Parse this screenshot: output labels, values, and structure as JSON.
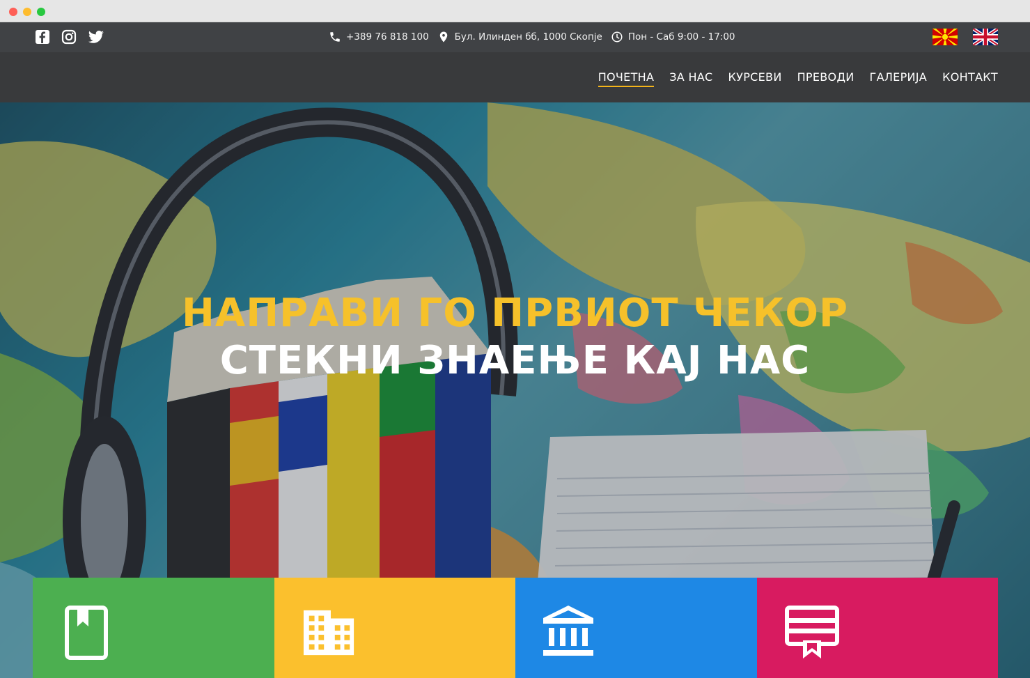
{
  "topbar": {
    "social": [
      {
        "icon": "facebook-icon"
      },
      {
        "icon": "instagram-icon"
      },
      {
        "icon": "twitter-icon"
      }
    ],
    "phone": "+389 76 818 100",
    "address": "Бул. Илинден бб, 1000 Скопје",
    "hours": "Пон - Саб 9:00 - 17:00",
    "languages": [
      {
        "icon": "macedonian-flag-icon"
      },
      {
        "icon": "uk-flag-icon"
      }
    ]
  },
  "nav": {
    "items": [
      "ПОЧЕТНА",
      "ЗА НАС",
      "КУРСЕВИ",
      "ПРЕВОДИ",
      "ГАЛЕРИЈА",
      "КОНТАКТ"
    ],
    "active": "ПОЧЕТНА"
  },
  "hero": {
    "title_line1": "НАПРАВИ ГО ПРВИОТ ЧЕКОР",
    "title_line2": "СТЕКНИ ЗНАЕЊЕ КАЈ НАС"
  },
  "tiles": [
    {
      "icon": "book-icon",
      "color": "#4caf50"
    },
    {
      "icon": "building-icon",
      "color": "#fbc02d"
    },
    {
      "icon": "institution-icon",
      "color": "#1e88e5"
    },
    {
      "icon": "certificate-icon",
      "color": "#d81b60"
    }
  ],
  "colors": {
    "accent": "#f6c12a",
    "topbar": "#404245",
    "navbar": "#393a3c"
  }
}
